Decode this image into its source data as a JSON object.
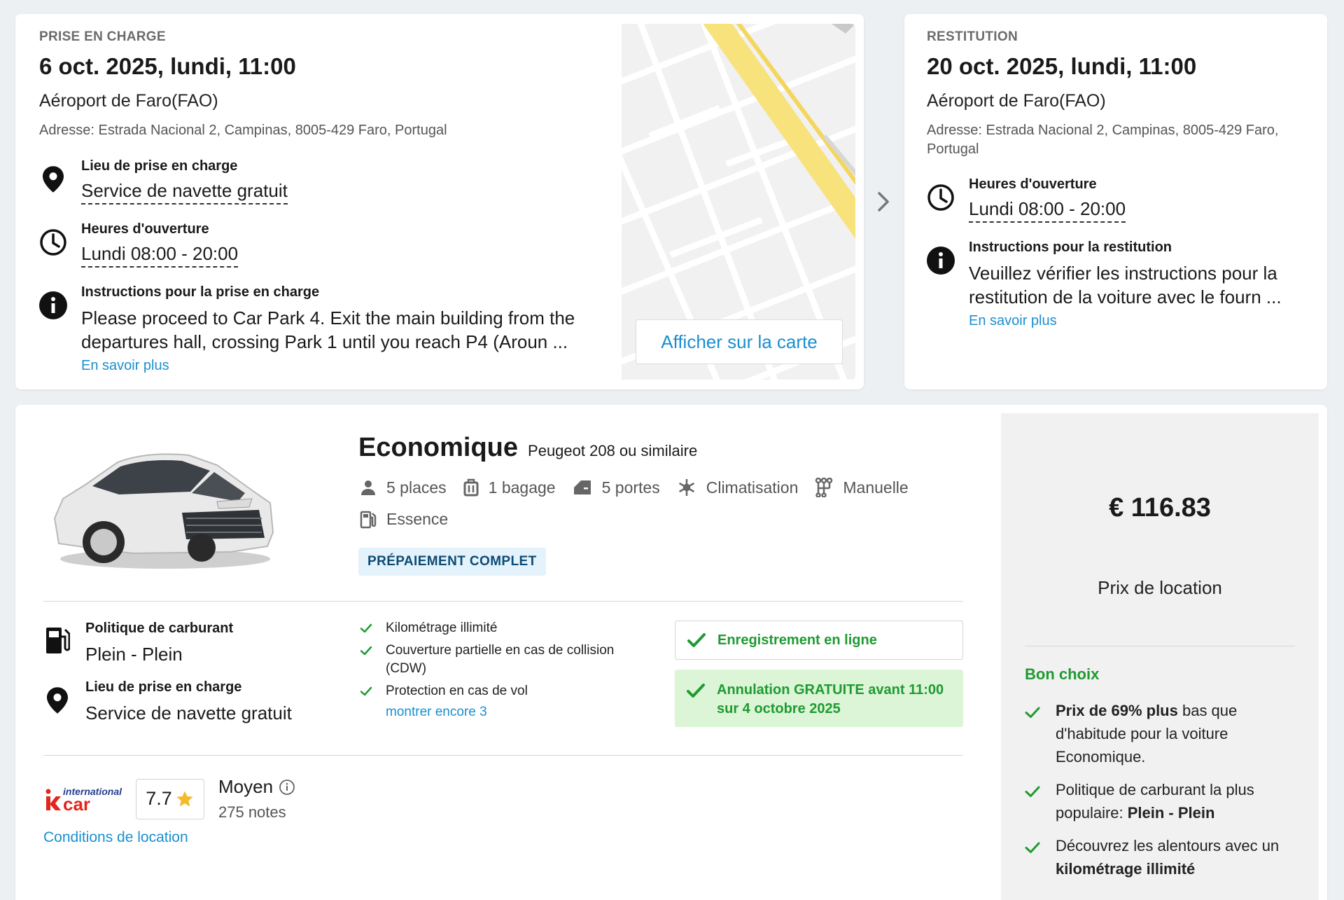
{
  "pickup": {
    "section_label": "PRISE EN CHARGE",
    "date": "6 oct. 2025, lundi, 11:00",
    "location_name": "Aéroport de Faro(FAO)",
    "address": "Adresse: Estrada Nacional 2, Campinas, 8005-429 Faro, Portugal",
    "place_title": "Lieu de prise en charge",
    "place_value": "Service de navette gratuit",
    "hours_title": "Heures d'ouverture",
    "hours_value": "Lundi 08:00 - 20:00",
    "instructions_title": "Instructions pour la prise en charge",
    "instructions_line1": "Please proceed to Car Park 4. Exit the main building from the",
    "instructions_line2": "departures hall, crossing Park 1 until you reach P4 (Aroun ...",
    "more_link": "En savoir plus",
    "map_button": "Afficher sur la carte"
  },
  "return": {
    "section_label": "RESTITUTION",
    "date": "20 oct. 2025, lundi, 11:00",
    "location_name": "Aéroport de Faro(FAO)",
    "address_line1": "Adresse: Estrada Nacional 2, Campinas, 8005-429 Faro,",
    "address_line2": "Portugal",
    "hours_title": "Heures d'ouverture",
    "hours_value": "Lundi 08:00 - 20:00",
    "instructions_title": "Instructions pour la restitution",
    "instructions_line1": "Veuillez vérifier les instructions pour la",
    "instructions_line2": "restitution de la voiture avec le fourn ...",
    "more_link": "En savoir plus"
  },
  "car": {
    "category": "Economique",
    "model": "Peugeot 208 ou similaire",
    "specs": {
      "seats": "5 places",
      "bags": "1 bagage",
      "doors": "5 portes",
      "ac": "Climatisation",
      "transmission": "Manuelle",
      "fuel": "Essence"
    },
    "badge": "PRÉPAIEMENT COMPLET"
  },
  "policies": {
    "fuel_title": "Politique de carburant",
    "fuel_value": "Plein - Plein",
    "pickup_title": "Lieu de prise en charge",
    "pickup_value": "Service de navette gratuit"
  },
  "features": {
    "item1": "Kilométrage illimité",
    "item2_line1": "Couverture partielle en cas de collision",
    "item2_line2": "(CDW)",
    "item3": "Protection en cas de vol",
    "show_more": "montrer encore 3"
  },
  "boxes": {
    "online": "Enregistrement en ligne",
    "cancel_line1": "Annulation GRATUITE avant 11:00",
    "cancel_line2": "sur 4 octobre 2025"
  },
  "supplier": {
    "logo_text_top": "international",
    "logo_text_bottom": "car",
    "rating": "7.7",
    "rating_label": "Moyen",
    "reviews": "275 notes",
    "conditions_link": "Conditions de location"
  },
  "price_panel": {
    "price": "€ 116.83",
    "price_label": "Prix de location",
    "good_choice_title": "Bon choix",
    "bullet1_bold": "Prix de 69% plus",
    "bullet1_rest_line1": " bas que",
    "bullet1_line2": "d'habitude pour la voiture",
    "bullet1_line3": "Economique.",
    "bullet2_line1": "Politique de carburant la plus",
    "bullet2_line2_pre": "populaire: ",
    "bullet2_line2_bold": "Plein - Plein",
    "bullet3_line1": "Découvrez les alentours avec un",
    "bullet3_line2_bold": "kilométrage illimité"
  },
  "colors": {
    "accent_link": "#1a8fd0",
    "success_green": "#1f9a32",
    "badge_bg": "#e4f2fb",
    "cancel_bg": "#dcf5d6"
  }
}
